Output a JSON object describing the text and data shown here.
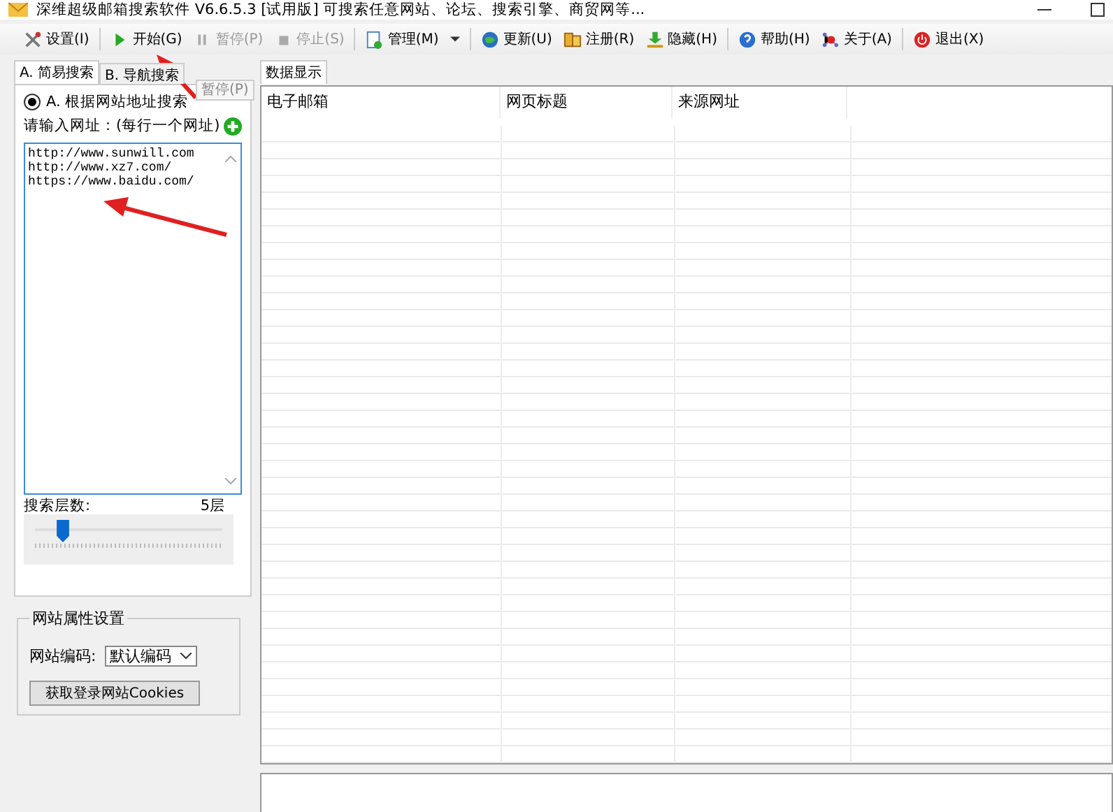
{
  "window": {
    "title": "深维超级邮箱搜索软件 V6.6.5.3 [试用版] 可搜索任意网站、论坛、搜索引擎、商贸网等..."
  },
  "toolbar": [
    {
      "label": "设置(I)",
      "disabled": false
    },
    {
      "label": "开始(G)",
      "disabled": false
    },
    {
      "label": "暂停(P)",
      "disabled": true
    },
    {
      "label": "停止(S)",
      "disabled": true
    },
    {
      "label": "管理(M)",
      "disabled": false,
      "dropdown": true
    },
    {
      "label": "更新(U)",
      "disabled": false
    },
    {
      "label": "注册(R)",
      "disabled": false
    },
    {
      "label": "隐藏(H)",
      "disabled": false
    },
    {
      "label": "帮助(H)",
      "disabled": false
    },
    {
      "label": "关于(A)",
      "disabled": false
    },
    {
      "label": "退出(X)",
      "disabled": false
    }
  ],
  "tooltip": "暂停(P)",
  "left_tabs": [
    {
      "label": "A. 简易搜索",
      "selected": true
    },
    {
      "label": "B. 导航搜索",
      "selected": false
    }
  ],
  "search_mode": {
    "label": "A. 根据网站地址搜索",
    "selected": true
  },
  "url_prompt": "请输入网址：(每行一个网址)",
  "urls": "http://www.sunwill.com\nhttp://www.xz7.com/\nhttps://www.baidu.com/",
  "depth": {
    "label": "搜索层数:",
    "reading": "5层",
    "level": 0.11
  },
  "site_settings": {
    "title": "网站属性设置",
    "encoding_label": "网站编码:",
    "encoding_value": "默认编码",
    "cookies_button": "获取登录网站Cookies"
  },
  "right_tabs": [
    {
      "label": "数据显示",
      "selected": true
    }
  ],
  "table": {
    "columns": [
      "电子邮箱",
      "网页标题",
      "来源网址"
    ]
  }
}
